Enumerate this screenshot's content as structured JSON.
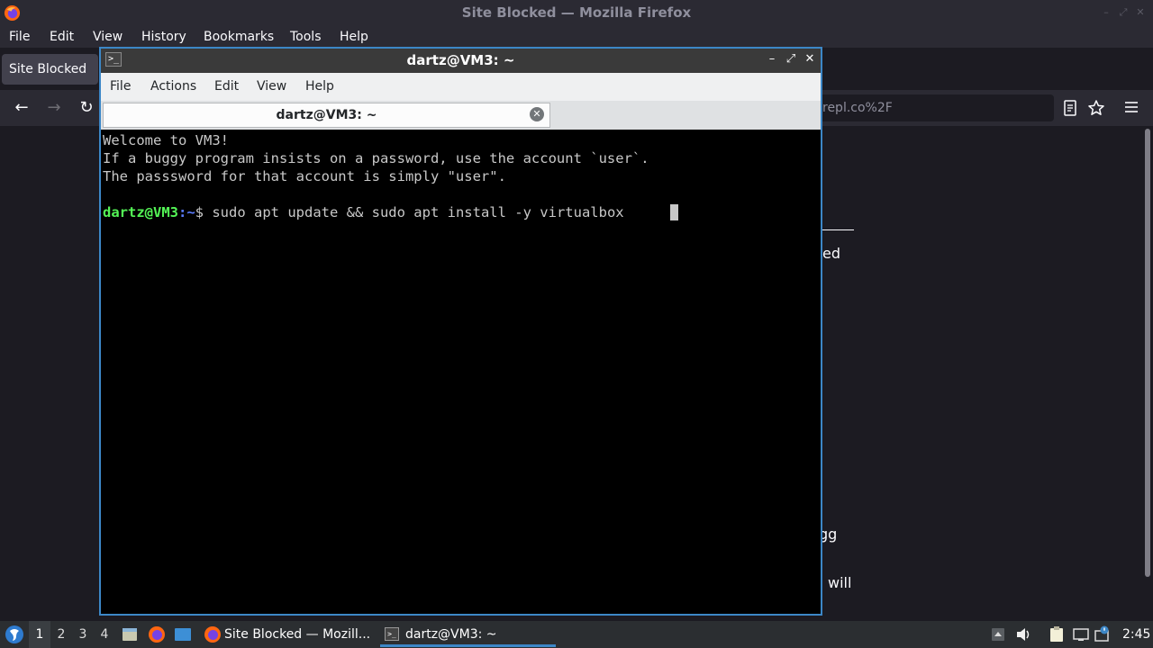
{
  "firefox": {
    "title": "Site Blocked — Mozilla Firefox",
    "menus": [
      "File",
      "Edit",
      "View",
      "History",
      "Bookmarks",
      "Tools",
      "Help"
    ],
    "tab_label": "Site Blocked",
    "url_fragment": "repl.co%2F",
    "content_fragments": [
      "ed",
      "gg",
      "will"
    ]
  },
  "terminal": {
    "title": "dartz@VM3: ~",
    "menus": [
      "File",
      "Actions",
      "Edit",
      "View",
      "Help"
    ],
    "tab_label": "dartz@VM3: ~",
    "lines": [
      "Welcome to VM3!",
      "If a buggy program insists on a password, use the account `user`.",
      "The passsword for that account is simply \"user\"."
    ],
    "prompt_user": "dartz@VM3",
    "prompt_path": ":~",
    "prompt_symbol": "$ ",
    "command": "sudo apt update && sudo apt install -y virtualbox"
  },
  "taskbar": {
    "workspaces": [
      "1",
      "2",
      "3",
      "4"
    ],
    "active_workspace": "1",
    "tasks": [
      "Site Blocked — Mozill...",
      "dartz@VM3: ~"
    ],
    "clock": "2:45"
  },
  "colors": {
    "accent": "#3c87c7",
    "prompt_user": "#54f556",
    "prompt_path": "#5b7cff"
  }
}
